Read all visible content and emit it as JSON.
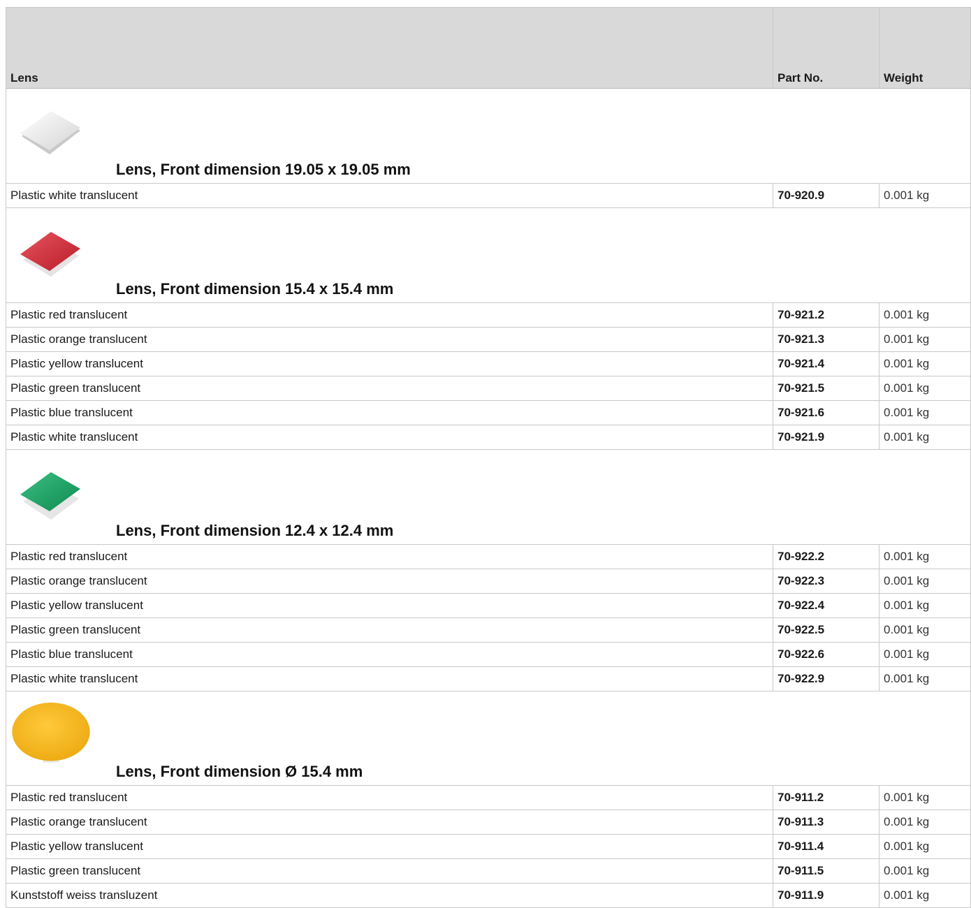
{
  "header": {
    "lens_label": "Lens",
    "part_label": "Part No.",
    "weight_label": "Weight"
  },
  "groups": [
    {
      "title": "Lens, Front dimension 19.05 x 19.05 mm",
      "lens_color": "#f0f0f0",
      "rows": [
        {
          "desc": "Plastic white translucent",
          "part": "70-920.9",
          "weight": "0.001 kg"
        }
      ]
    },
    {
      "title": "Lens, Front dimension 15.4 x 15.4 mm",
      "lens_color": "#d42a36",
      "rows": [
        {
          "desc": "Plastic red translucent",
          "part": "70-921.2",
          "weight": "0.001 kg"
        },
        {
          "desc": "Plastic orange translucent",
          "part": "70-921.3",
          "weight": "0.001 kg"
        },
        {
          "desc": "Plastic yellow translucent",
          "part": "70-921.4",
          "weight": "0.001 kg"
        },
        {
          "desc": "Plastic green translucent",
          "part": "70-921.5",
          "weight": "0.001 kg"
        },
        {
          "desc": "Plastic blue translucent",
          "part": "70-921.6",
          "weight": "0.001 kg"
        },
        {
          "desc": "Plastic white translucent",
          "part": "70-921.9",
          "weight": "0.001 kg"
        }
      ]
    },
    {
      "title": "Lens, Front dimension 12.4 x 12.4 mm",
      "lens_color": "#17a062",
      "rows": [
        {
          "desc": "Plastic red translucent",
          "part": "70-922.2",
          "weight": "0.001 kg"
        },
        {
          "desc": "Plastic orange translucent",
          "part": "70-922.3",
          "weight": "0.001 kg"
        },
        {
          "desc": "Plastic yellow translucent",
          "part": "70-922.4",
          "weight": "0.001 kg"
        },
        {
          "desc": "Plastic green translucent",
          "part": "70-922.5",
          "weight": "0.001 kg"
        },
        {
          "desc": "Plastic blue translucent",
          "part": "70-922.6",
          "weight": "0.001 kg"
        },
        {
          "desc": "Plastic white translucent",
          "part": "70-922.9",
          "weight": "0.001 kg"
        }
      ]
    },
    {
      "title": "Lens, Front dimension Ø 15.4 mm",
      "lens_color": "#f5b81b",
      "rows": [
        {
          "desc": "Plastic red translucent",
          "part": "70-911.2",
          "weight": "0.001 kg"
        },
        {
          "desc": "Plastic orange translucent",
          "part": "70-911.3",
          "weight": "0.001 kg"
        },
        {
          "desc": "Plastic yellow translucent",
          "part": "70-911.4",
          "weight": "0.001 kg"
        },
        {
          "desc": "Plastic green translucent",
          "part": "70-911.5",
          "weight": "0.001 kg"
        },
        {
          "desc": "Kunststoff weiss transluzent",
          "part": "70-911.9",
          "weight": "0.001 kg"
        }
      ]
    }
  ]
}
